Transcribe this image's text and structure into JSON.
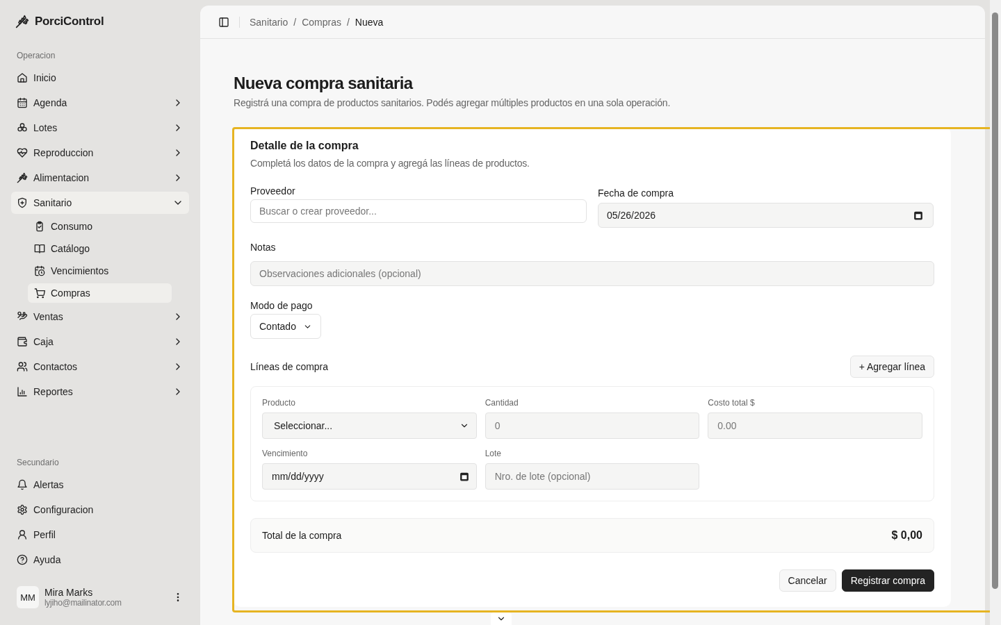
{
  "sidebar": {
    "brand": "PorciControl",
    "sections": [
      {
        "label": "Operacion",
        "items": [
          {
            "label": "Inicio",
            "kind": "link",
            "selected": false
          },
          {
            "label": "Agenda",
            "kind": "group",
            "expanded": false,
            "selected": false
          },
          {
            "label": "Lotes",
            "kind": "group",
            "expanded": false,
            "selected": false
          },
          {
            "label": "Reproduccion",
            "kind": "group",
            "expanded": false,
            "selected": false
          },
          {
            "label": "Alimentacion",
            "kind": "group",
            "expanded": false,
            "selected": false
          },
          {
            "label": "Sanitario",
            "kind": "group",
            "expanded": true,
            "selected": true,
            "children": [
              {
                "label": "Consumo",
                "selected": false
              },
              {
                "label": "Catálogo",
                "selected": false
              },
              {
                "label": "Vencimientos",
                "selected": false
              },
              {
                "label": "Compras",
                "selected": true
              }
            ]
          },
          {
            "label": "Ventas",
            "kind": "group",
            "expanded": false,
            "selected": false
          },
          {
            "label": "Caja",
            "kind": "group",
            "expanded": false,
            "selected": false
          },
          {
            "label": "Contactos",
            "kind": "group",
            "expanded": false,
            "selected": false
          },
          {
            "label": "Reportes",
            "kind": "group",
            "expanded": false,
            "selected": false
          }
        ]
      },
      {
        "label": "Secundario",
        "items": [
          {
            "label": "Alertas",
            "kind": "link",
            "selected": false
          },
          {
            "label": "Configuracion",
            "kind": "link",
            "selected": false
          },
          {
            "label": "Perfil",
            "kind": "link",
            "selected": false
          },
          {
            "label": "Ayuda",
            "kind": "link",
            "selected": false
          }
        ]
      }
    ],
    "user": {
      "initials": "MM",
      "name": "Mira Marks",
      "email": "lyjiho@mailinator.com"
    }
  },
  "breadcrumb": [
    {
      "label": "Sanitario",
      "current": false
    },
    {
      "label": "Compras",
      "current": false,
      "separator": "/"
    },
    {
      "label": "Nueva",
      "current": true,
      "separator": "/"
    }
  ],
  "page": {
    "title": "Nueva compra sanitaria",
    "subtitle": "Registrá una compra de productos sanitarios. Podés agregar múltiples productos en una sola operación."
  },
  "card": {
    "title": "Detalle de la compra",
    "description": "Completá los datos de la compra y agregá las líneas de productos.",
    "proveedor": {
      "label": "Proveedor",
      "placeholder": "Buscar o crear proveedor..."
    },
    "fecha": {
      "label": "Fecha de compra",
      "value": "05/26/2026"
    },
    "notas": {
      "label": "Notas",
      "placeholder": "Observaciones adicionales (opcional)"
    },
    "modo_pago": {
      "label": "Modo de pago",
      "value": "Contado"
    },
    "lineas": {
      "title": "Líneas de compra",
      "add_button": "+ Agregar línea",
      "fields": [
        {
          "kind": "select",
          "label": "Producto",
          "value": "Seleccionar..."
        },
        {
          "kind": "text",
          "label": "Cantidad",
          "placeholder": "0"
        },
        {
          "kind": "text",
          "label": "Costo total $",
          "placeholder": "0.00"
        },
        {
          "kind": "date",
          "label": "Vencimiento",
          "value": "mm/dd/yyyy"
        },
        {
          "kind": "text",
          "label": "Lote",
          "placeholder": "Nro. de lote (opcional)"
        }
      ]
    },
    "total": {
      "label": "Total de la compra",
      "value": "$ 0,00"
    },
    "buttons": [
      {
        "label": "Cancelar",
        "kind": "secondary"
      },
      {
        "label": "Registrar compra",
        "kind": "primary"
      }
    ]
  }
}
